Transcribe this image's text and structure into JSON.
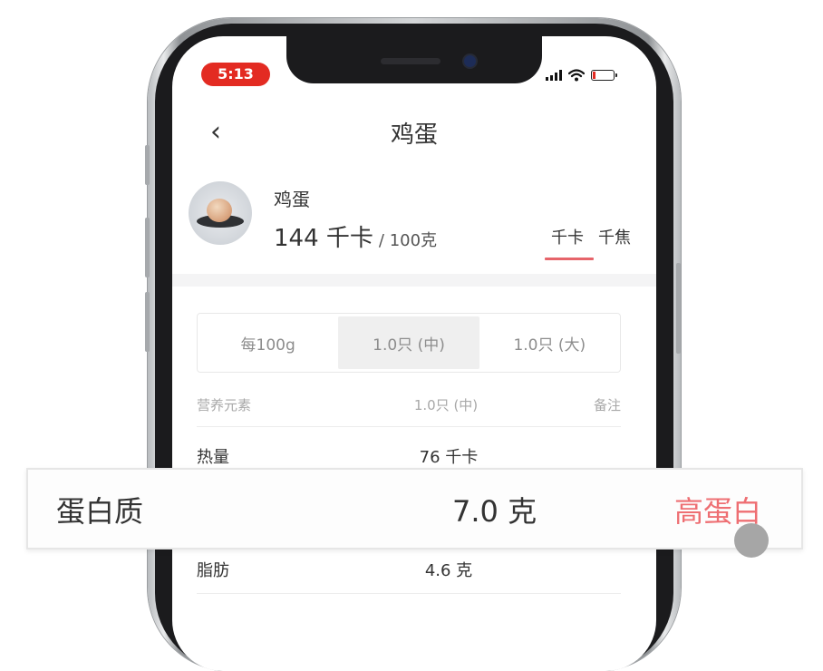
{
  "status_bar": {
    "time": "5:13"
  },
  "nav": {
    "back_glyph": "‹",
    "title": "鸡蛋"
  },
  "food": {
    "image_icon": "egg-plate-icon",
    "name": "鸡蛋",
    "energy_value": "144 千卡",
    "energy_per": "/ 100克"
  },
  "unit_tabs": {
    "items": [
      "千卡",
      "千焦"
    ],
    "selected": "千卡"
  },
  "portion_tabs": {
    "items": [
      "每100g",
      "1.0只 (中)",
      "1.0只 (大)"
    ],
    "selected": "1.0只 (中)"
  },
  "table": {
    "headers": [
      "营养元素",
      "1.0只 (中)",
      "备注"
    ],
    "rows": [
      {
        "name": "热量",
        "value": "76 千卡",
        "note": ""
      },
      {
        "name": "脂肪",
        "value": "4.6 克",
        "note": ""
      }
    ]
  },
  "callout": {
    "name": "蛋白质",
    "value": "7.0 克",
    "note": "高蛋白"
  },
  "colors": {
    "accent": "#e6646a",
    "time_pill": "#e32b22",
    "note_red": "#ee6f73"
  }
}
